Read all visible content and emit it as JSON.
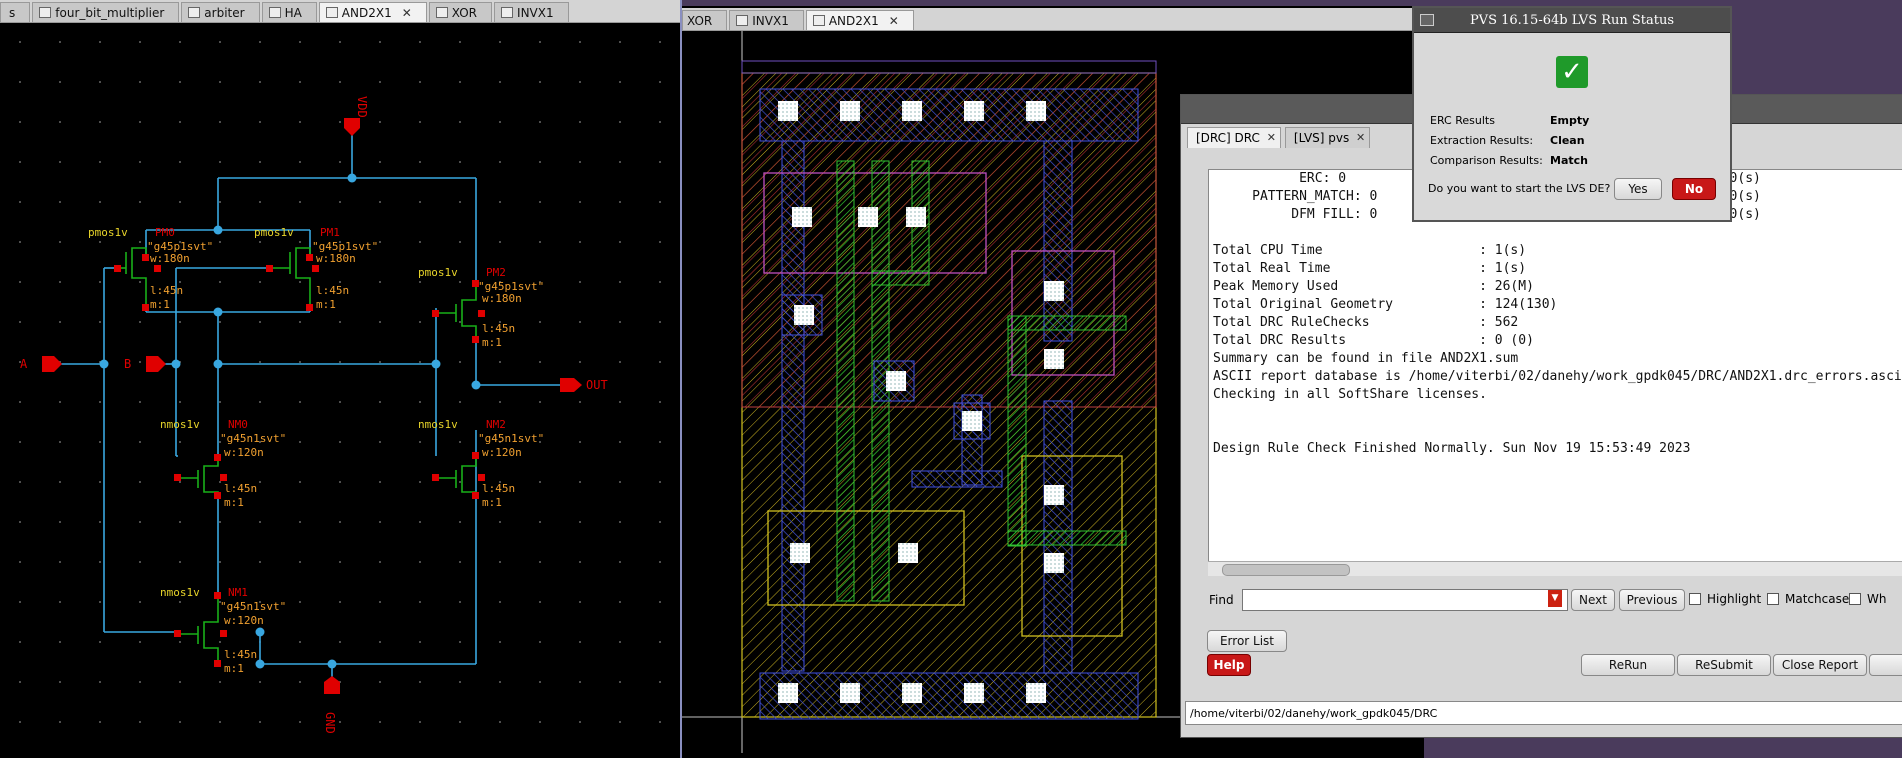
{
  "schematic": {
    "tabs": [
      {
        "label": "four_bit_multiplier"
      },
      {
        "label": "arbiter"
      },
      {
        "label": "HA"
      },
      {
        "label": "AND2X1"
      },
      {
        "label": "XOR"
      },
      {
        "label": "INVX1"
      }
    ],
    "active_tab": "AND2X1",
    "pins": {
      "vdd": "VDD",
      "gnd": "GND",
      "a": "A",
      "b": "B",
      "out": "OUT"
    },
    "devices": {
      "pm0": {
        "type": "pmos1v",
        "name": "PM0",
        "model": "\"g45p1svt\"",
        "w": "w:180n",
        "l": "l:45n",
        "m": "m:1"
      },
      "pm1": {
        "type": "pmos1v",
        "name": "PM1",
        "model": "\"g45p1svt\"",
        "w": "w:180n",
        "l": "l:45n",
        "m": "m:1"
      },
      "pm2": {
        "type": "pmos1v",
        "name": "PM2",
        "model": "\"g45p1svt\"",
        "w": "w:180n",
        "l": "l:45n",
        "m": "m:1"
      },
      "nm0": {
        "type": "nmos1v",
        "name": "NM0",
        "model": "\"g45n1svt\"",
        "w": "w:120n",
        "l": "l:45n",
        "m": "m:1"
      },
      "nm1": {
        "type": "nmos1v",
        "name": "NM1",
        "model": "\"g45n1svt\"",
        "w": "w:120n",
        "l": "l:45n",
        "m": "m:1"
      },
      "nm2": {
        "type": "nmos1v",
        "name": "NM2",
        "model": "\"g45n1svt\"",
        "w": "w:120n",
        "l": "l:45n",
        "m": "m:1"
      }
    }
  },
  "layout": {
    "tabs": [
      {
        "label": "XOR"
      },
      {
        "label": "INVX1"
      },
      {
        "label": "AND2X1"
      }
    ],
    "active_tab": "AND2X1"
  },
  "lvs": {
    "title": "PVS 16.15-64b LVS  Run Status",
    "rows": [
      {
        "label": "ERC Results",
        "value": "Empty"
      },
      {
        "label": "Extraction Results:",
        "value": "Clean"
      },
      {
        "label": "Comparison Results:",
        "value": "Match"
      }
    ],
    "question": "Do you want to start the LVS DE?",
    "yes": "Yes",
    "no": "No"
  },
  "drc": {
    "tabs": [
      {
        "label": "[DRC] DRC"
      },
      {
        "label": "[LVS] pvs"
      }
    ],
    "report_text": "           ERC: 0                                    L =          0(s)\n     PATTERN_MATCH: 0                                L =          0(s)\n          DFM FILL: 0                                L =          0(s)\n\nTotal CPU Time                    : 1(s)\nTotal Real Time                   : 1(s)\nPeak Memory Used                  : 26(M)\nTotal Original Geometry           : 124(130)\nTotal DRC RuleChecks              : 562\nTotal DRC Results                 : 0 (0)\nSummary can be found in file AND2X1.sum\nASCII report database is /home/viterbi/02/danehy/work_gpdk045/DRC/AND2X1.drc_errors.ascii\nChecking in all SoftShare licenses.\n\n\nDesign Rule Check Finished Normally. Sun Nov 19 15:53:49 2023",
    "find_label": "Find",
    "find_value": "",
    "next": "Next",
    "previous": "Previous",
    "highlight": "Highlight",
    "matchcase": "Matchcase",
    "wh": "Wh",
    "error_list": "Error List",
    "help": "Help",
    "rerun": "ReRun",
    "resubmit": "ReSubmit",
    "close_report": "Close Report",
    "status_path": "/home/viterbi/02/danehy/work_gpdk045/DRC"
  },
  "colors": {
    "wire": "#39a7e0",
    "pin": "#e00000",
    "device": "#19b019",
    "label_yellow": "#e8d42a",
    "label_orange": "#f0a030"
  }
}
